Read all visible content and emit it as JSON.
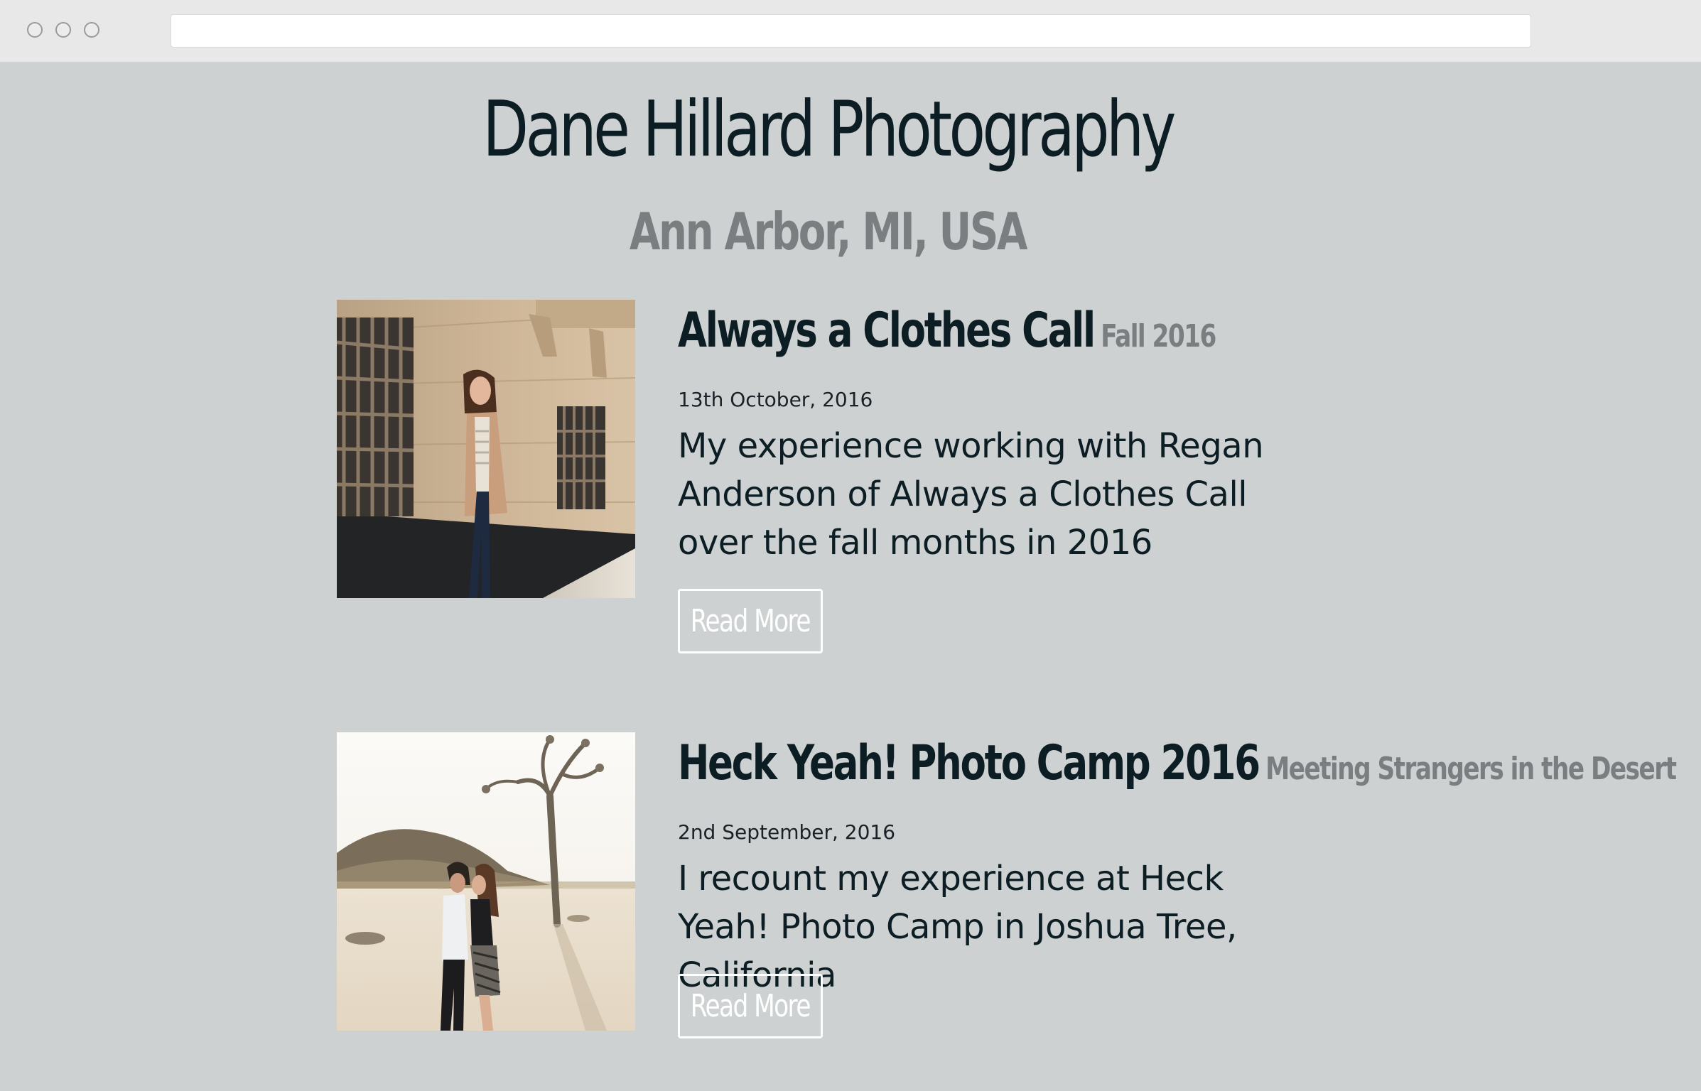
{
  "site": {
    "title": "Dane Hillard Photography",
    "location": "Ann Arbor, MI, USA"
  },
  "posts": [
    {
      "title": "Always a Clothes Call",
      "tagline": "Fall 2016",
      "date": "13th October, 2016",
      "excerpt": "My experience working with Regan Anderson of Always a Clothes Call over the fall months in 2016",
      "read_more_label": "Read More"
    },
    {
      "title": "Heck Yeah! Photo Camp 2016",
      "tagline": "Meeting Strangers in the Desert",
      "date": "2nd September, 2016",
      "excerpt": "I recount my experience at Heck Yeah! Photo Camp in Joshua Tree, California",
      "read_more_label": "Read More"
    }
  ]
}
